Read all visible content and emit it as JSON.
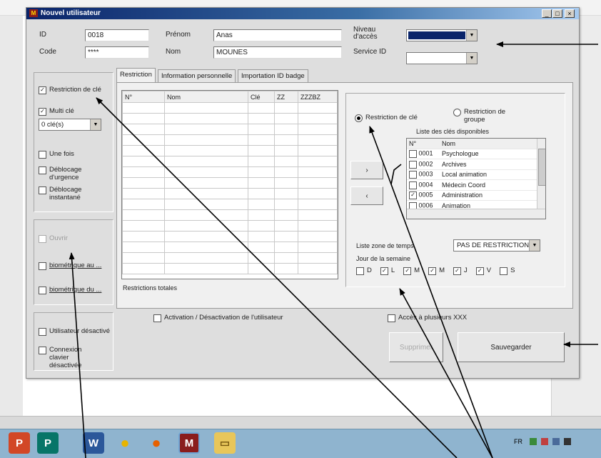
{
  "window": {
    "title": "Nouvel utilisateur"
  },
  "header": {
    "id_label": "ID",
    "id_value": "0018",
    "code_label": "Code",
    "code_value": "****",
    "prenom_label": "Prénom",
    "prenom_value": "Anas",
    "nom_label": "Nom",
    "nom_value": "MOUNES",
    "niveau_label": "Niveau d'accès",
    "niveau_value": "",
    "service_label": "Service ID",
    "service_value": ""
  },
  "left_panel": {
    "restriction_cle": "Restriction de clé",
    "multi_cle": "Multi clé",
    "cle_select": "0 clé(s)",
    "une_fois": "Une fois",
    "deblocage_urgence": "Déblocage d'urgence",
    "deblocage_instantane": "Déblocage instantané",
    "option_gray": "Ouvrir",
    "biometrique_1": "biométrique au ...",
    "biometrique_2": "biométrique du ...",
    "utilisateur_desactive": "Utilisateur désactivé",
    "connexion_clavier": "Connexion clavier désactivée"
  },
  "tabs": [
    "Restriction",
    "Information personnelle",
    "Importation ID badge"
  ],
  "restriction_table": {
    "columns": [
      "N°",
      "Nom",
      "Clé",
      "ZZ",
      "ZZZBZ"
    ],
    "footer": "Restrictions totales"
  },
  "right_panel": {
    "radio_restriction_cle": "Restriction de clé",
    "radio_restriction_groupe": "Restriction de groupe",
    "list_title": "Liste des clés disponibles",
    "list_columns": [
      "N°",
      "Nom"
    ],
    "keys": [
      {
        "num": "0001",
        "name": "Psychologue",
        "checked": false
      },
      {
        "num": "0002",
        "name": "Archives",
        "checked": false
      },
      {
        "num": "0003",
        "name": "Local animation",
        "checked": false
      },
      {
        "num": "0004",
        "name": "Médecin Coord",
        "checked": false
      },
      {
        "num": "0005",
        "name": "Administration",
        "checked": true
      },
      {
        "num": "0006",
        "name": "Animation",
        "checked": false
      }
    ],
    "add_button": "›",
    "remove_button": "‹",
    "zone_label": "Liste zone de temps",
    "zone_value": "PAS DE RESTRICTIONS",
    "jours_label": "Jour de la semaine",
    "days": [
      {
        "label": "D",
        "checked": false
      },
      {
        "label": "L",
        "checked": true
      },
      {
        "label": "M",
        "checked": true
      },
      {
        "label": "M",
        "checked": true
      },
      {
        "label": "J",
        "checked": true
      },
      {
        "label": "V",
        "checked": true
      },
      {
        "label": "S",
        "checked": false
      }
    ]
  },
  "bottom": {
    "activation": "Activation / Désactivation de l'utilisateur",
    "acces_plusieurs": "Accès à plusieurs XXX",
    "disabled_button": "Supprimer",
    "save_button": "Sauvegarder"
  },
  "taskbar": {
    "apps": [
      {
        "name": "powerpoint",
        "glyph": "P",
        "color": "#d24726"
      },
      {
        "name": "publisher",
        "glyph": "P",
        "color": "#077568"
      },
      {
        "name": "word",
        "glyph": "W",
        "color": "#2b579a"
      },
      {
        "name": "chrome",
        "glyph": "●",
        "color": "#e8b400"
      },
      {
        "name": "firefox",
        "glyph": "●",
        "color": "#e66000"
      },
      {
        "name": "app-m",
        "glyph": "M",
        "color": "#8a1d1d"
      },
      {
        "name": "explorer",
        "glyph": "▭",
        "color": "#e8c65a"
      }
    ],
    "tray_text": "FR"
  },
  "colors": {
    "arrow": "#000000",
    "titlebar": "#0a246a"
  }
}
